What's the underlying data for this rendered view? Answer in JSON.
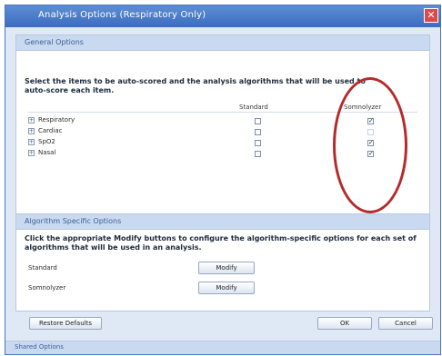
{
  "window": {
    "title": "Analysis Options (Respiratory Only)",
    "close_glyph": "✕"
  },
  "general": {
    "header": "General Options",
    "instruction": "Select the items to be auto-scored and the analysis algorithms that will be used to auto-score each item.",
    "columns": [
      "Standard",
      "Somnolyzer"
    ],
    "rows": [
      {
        "expander": "+",
        "label": "Respiratory",
        "standard": false,
        "somnolyzer": true
      },
      {
        "expander": "+",
        "label": "Cardiac",
        "standard": false,
        "somnolyzer": false
      },
      {
        "expander": "+",
        "label": "SpO2",
        "standard": false,
        "somnolyzer": true
      },
      {
        "expander": "+",
        "label": "Nasal",
        "standard": false,
        "somnolyzer": true
      }
    ],
    "check_glyph": "✓"
  },
  "algorithm": {
    "header": "Algorithm Specific Options",
    "instruction": "Click the appropriate Modify buttons to configure the algorithm-specific options for each set of algorithms that will be used in an analysis.",
    "items": [
      {
        "label": "Standard",
        "button": "Modify"
      },
      {
        "label": "Somnolyzer",
        "button": "Modify"
      }
    ]
  },
  "buttons": {
    "restore": "Restore Defaults",
    "ok": "OK",
    "cancel": "Cancel"
  },
  "footer": {
    "label": "Shared Options"
  },
  "colors": {
    "highlight": "#b52b2b",
    "title_bar": "#3b6cc0"
  }
}
